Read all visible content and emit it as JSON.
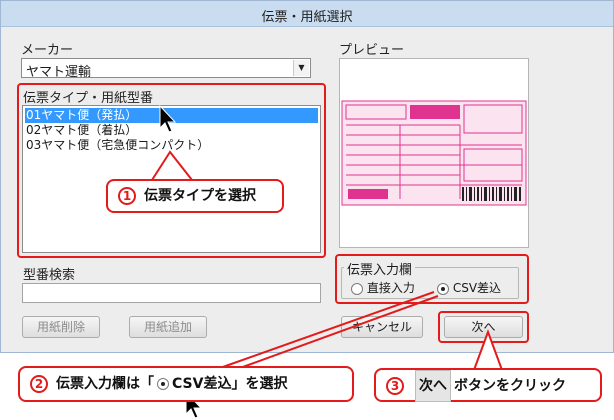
{
  "window": {
    "title": "伝票・用紙選択"
  },
  "maker": {
    "label": "メーカー",
    "selected": "ヤマト運輸"
  },
  "slip_type": {
    "label": "伝票タイプ・用紙型番",
    "items": [
      "01ヤマト便（発払）",
      "02ヤマト便（着払）",
      "03ヤマト便（宅急便コンパクト）"
    ],
    "selected_index": 0
  },
  "preview": {
    "label": "プレビュー"
  },
  "model_search": {
    "label": "型番検索",
    "value": ""
  },
  "input_mode": {
    "label": "伝票入力欄",
    "options": [
      "直接入力",
      "CSV差込"
    ],
    "selected_index": 1
  },
  "buttons": {
    "delete_paper": "用紙削除",
    "add_paper": "用紙追加",
    "cancel": "キャンセル",
    "next": "次へ"
  },
  "callouts": {
    "step1": {
      "num": "1",
      "text": "伝票タイプを選択"
    },
    "step2": {
      "num": "2",
      "prefix": "伝票入力欄は「",
      "option": "CSV差込",
      "suffix": "」を選択"
    },
    "step3": {
      "num": "3",
      "key": "次へ",
      "text": "ボタンをクリック"
    }
  },
  "colors": {
    "annotation": "#e31b1b",
    "selection": "#3399ff",
    "preview_pink": "#e0338f"
  }
}
